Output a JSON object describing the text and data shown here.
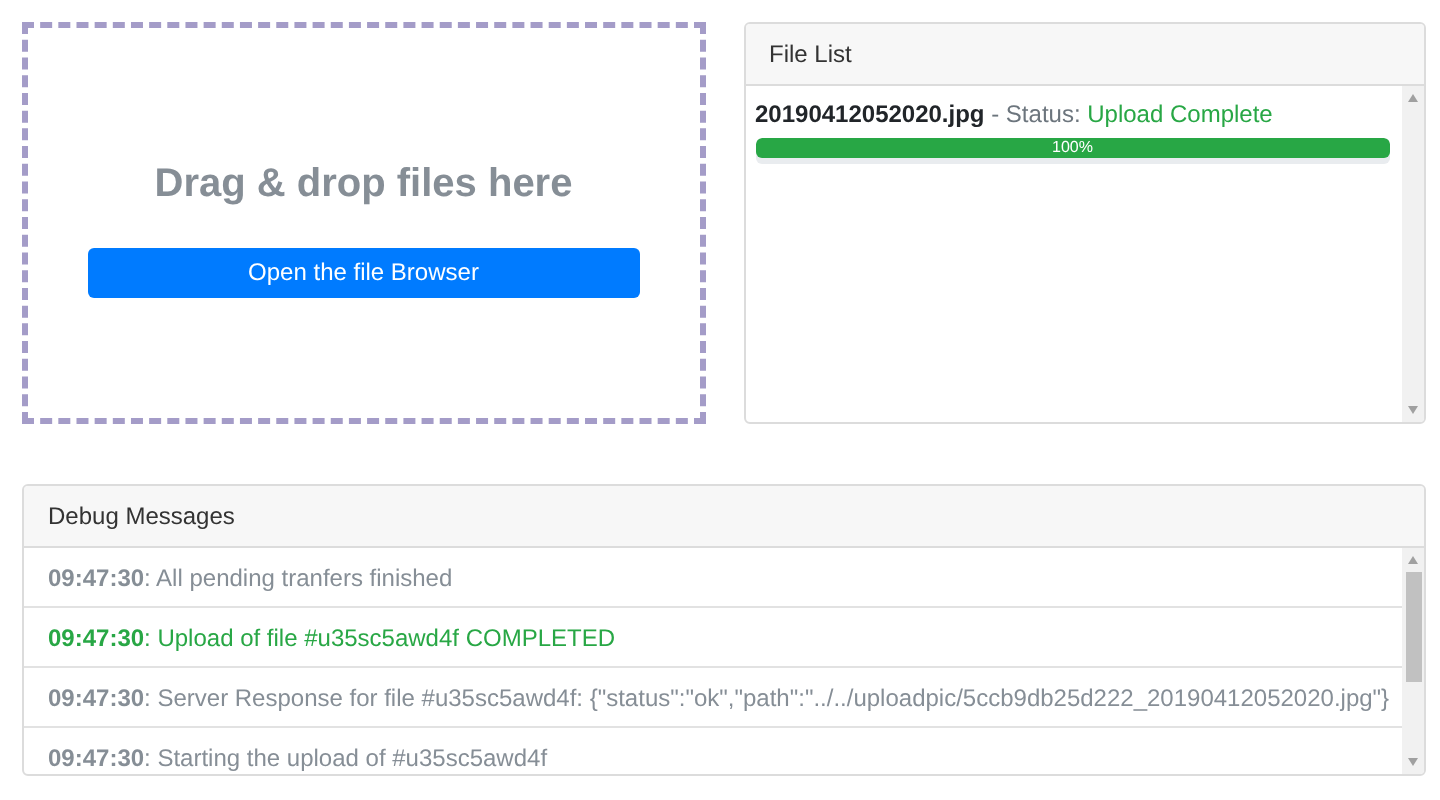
{
  "dropzone": {
    "title": "Drag & drop files here",
    "button": "Open the file Browser"
  },
  "file_list": {
    "title": "File List",
    "files": [
      {
        "name": "20190412052020.jpg",
        "separator": " - Status: ",
        "status": "Upload Complete",
        "kind": "complete",
        "level": 1.0,
        "reading": "100%"
      }
    ]
  },
  "debug": {
    "title": "Debug Messages",
    "messages": [
      {
        "time": "09:47:30",
        "text": ": All pending tranfers finished",
        "kind": "info"
      },
      {
        "time": "09:47:30",
        "text": ": Upload of file #u35sc5awd4f COMPLETED",
        "kind": "success"
      },
      {
        "time": "09:47:30",
        "text": ": Server Response for file #u35sc5awd4f: {\"status\":\"ok\",\"path\":\"../../uploadpic/5ccb9db25d222_20190412052020.jpg\"}",
        "kind": "info"
      },
      {
        "time": "09:47:30",
        "text": ": Starting the upload of #u35sc5awd4f",
        "kind": "info"
      }
    ]
  }
}
